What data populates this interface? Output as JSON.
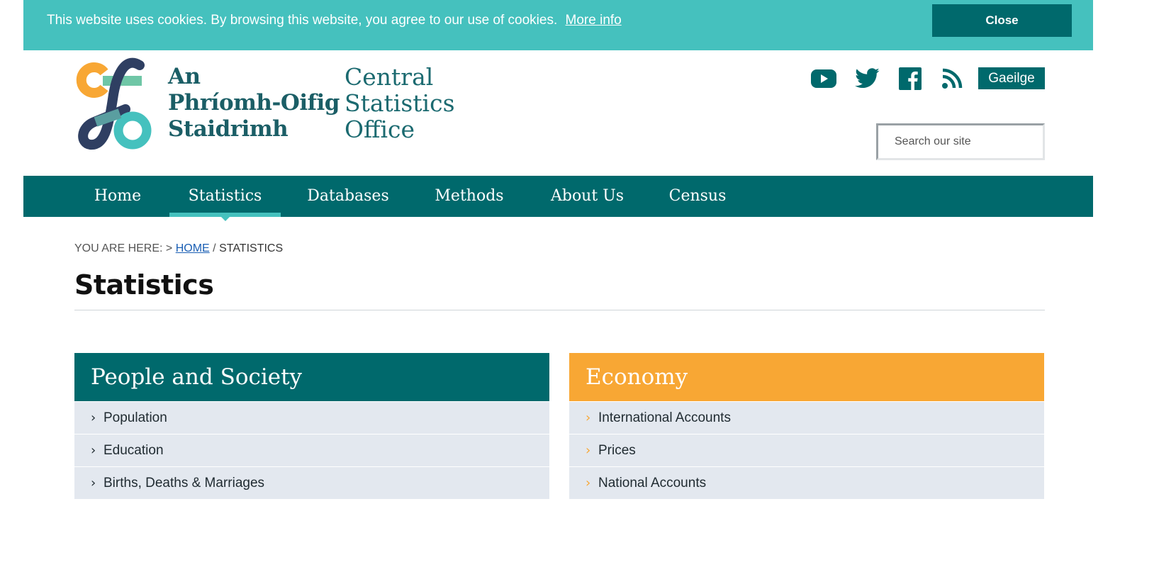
{
  "cookie_banner": {
    "text": "This website uses cookies. By browsing this website, you agree to our use of cookies.",
    "link_label": "More info",
    "close_label": "Close"
  },
  "logo": {
    "irish_lines": [
      "An",
      "Phríomh-Oifig",
      "Staidrimh"
    ],
    "english_lines": [
      "Central",
      "Statistics",
      "Office"
    ],
    "colors": {
      "orange": "#f8a734",
      "teal": "#45c1be",
      "navy": "#2f3f62",
      "green": "#6fc6a6"
    }
  },
  "header": {
    "social_icons": [
      "youtube-icon",
      "twitter-icon",
      "facebook-icon",
      "rss-icon"
    ],
    "language_button": "Gaeilge",
    "search_placeholder": "Search our site"
  },
  "nav": {
    "items": [
      {
        "label": "Home",
        "active": false
      },
      {
        "label": "Statistics",
        "active": true
      },
      {
        "label": "Databases",
        "active": false
      },
      {
        "label": "Methods",
        "active": false
      },
      {
        "label": "About Us",
        "active": false
      },
      {
        "label": "Census",
        "active": false
      }
    ]
  },
  "breadcrumb": {
    "prefix": "YOU ARE HERE: > ",
    "home": "HOME",
    "separator": " / ",
    "current": "STATISTICS"
  },
  "page_title": "Statistics",
  "panels": [
    {
      "title": "People and Society",
      "color": "#00696c",
      "chevron_color": "#1f2a30",
      "items": [
        "Population",
        "Education",
        "Births, Deaths & Marriages"
      ]
    },
    {
      "title": "Economy",
      "color": "#f8a734",
      "chevron_color": "#f8a734",
      "items": [
        "International Accounts",
        "Prices",
        "National Accounts"
      ]
    }
  ],
  "theme": {
    "primary": "#00696c",
    "accent": "#45c1be",
    "orange": "#f8a734",
    "link": "#1a5fb4"
  }
}
